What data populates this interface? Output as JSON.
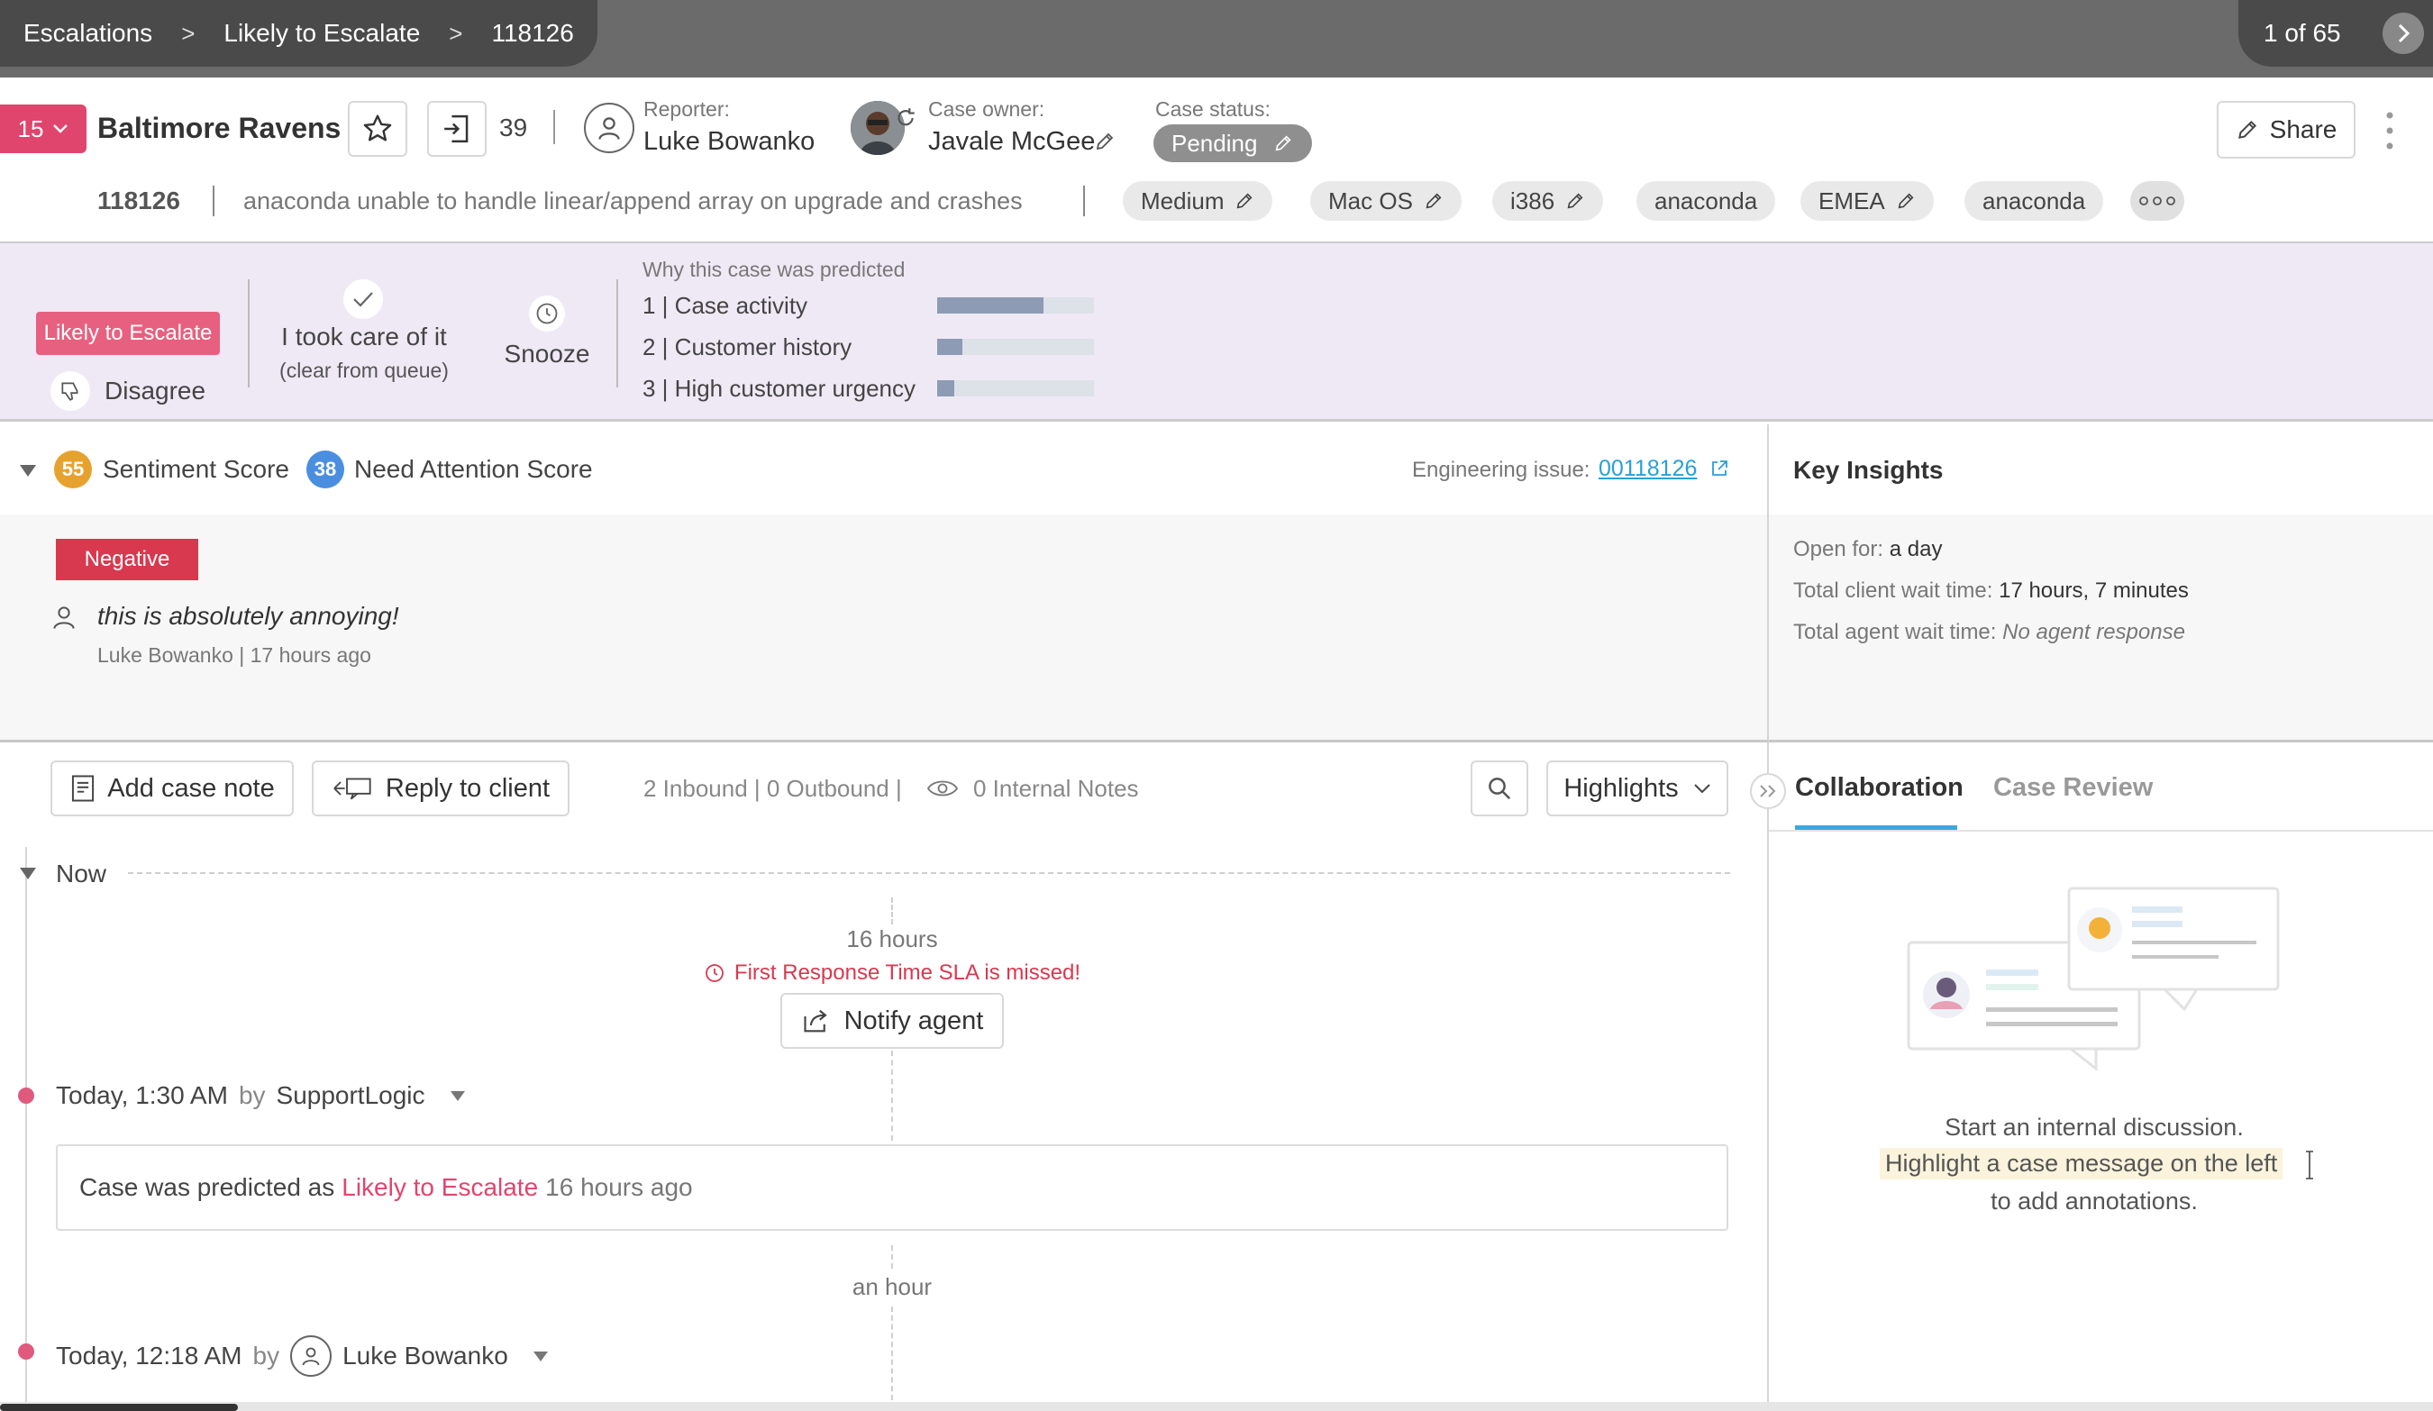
{
  "breadcrumb": {
    "items": [
      "Escalations",
      "Likely to Escalate",
      "118126"
    ]
  },
  "pager": {
    "text": "1 of 65"
  },
  "header": {
    "priority": "15",
    "account": "Baltimore Ravens",
    "count": "39",
    "reporter_label": "Reporter:",
    "reporter": "Luke Bowanko",
    "owner_label": "Case owner:",
    "owner": "Javale McGee",
    "status_label": "Case status:",
    "status": "Pending",
    "share": "Share"
  },
  "case": {
    "id": "118126",
    "subject": "anaconda unable to handle linear/append array on upgrade and crashes",
    "tags": [
      "Medium",
      "Mac OS",
      "i386",
      "anaconda",
      "EMEA",
      "anaconda"
    ],
    "tags_editable": [
      true,
      true,
      true,
      false,
      true,
      false
    ]
  },
  "prediction": {
    "badge": "Likely to Escalate",
    "disagree": "Disagree",
    "took_care": "I took care of it",
    "took_care_sub": "(clear from queue)",
    "snooze": "Snooze",
    "why_title": "Why this case was predicted",
    "reasons": [
      {
        "label": "1 | Case activity",
        "value": 0.68
      },
      {
        "label": "2 | Customer history",
        "value": 0.16
      },
      {
        "label": "3 | High customer urgency",
        "value": 0.11
      }
    ]
  },
  "scores": {
    "sentiment_value": "55",
    "sentiment_label": "Sentiment Score",
    "attention_value": "38",
    "attention_label": "Need Attention Score",
    "engineering_label": "Engineering issue:",
    "engineering_link": "00118126",
    "sentiment_badge": "Negative",
    "quote": "this is absolutely annoying!",
    "quote_meta": "Luke Bowanko | 17 hours ago"
  },
  "insights": {
    "title": "Key Insights",
    "open_label": "Open for:",
    "open_value": "a day",
    "client_wait_label": "Total client wait time:",
    "client_wait_value": "17 hours, 7 minutes",
    "agent_wait_label": "Total agent wait time:",
    "agent_wait_value": "No agent response"
  },
  "toolbar": {
    "add_note": "Add case note",
    "reply": "Reply to client",
    "counts": "2 Inbound | 0 Outbound |",
    "internal": "0 Internal Notes",
    "highlights": "Highlights"
  },
  "timeline": {
    "now": "Now",
    "gap1": "16 hours",
    "sla": "First Response Time SLA is missed!",
    "notify": "Notify agent",
    "event1_time": "Today, 1:30 AM",
    "by": "by",
    "event1_author": "SupportLogic",
    "event1_prefix": "Case was predicted as",
    "event1_link": "Likely to Escalate",
    "event1_suffix": "16 hours ago",
    "gap2": "an hour",
    "event2_time": "Today, 12:18 AM",
    "event2_author": "Luke Bowanko"
  },
  "side": {
    "tab1": "Collaboration",
    "tab2": "Case Review",
    "empty1": "Start an internal discussion.",
    "empty2": "Highlight a case message on the left",
    "empty3": "to add annotations."
  },
  "colors": {
    "accent": "#e0456d",
    "link": "#2a9fd8",
    "purple_band": "#efe9f6",
    "tab_active": "#3ea8dc"
  }
}
